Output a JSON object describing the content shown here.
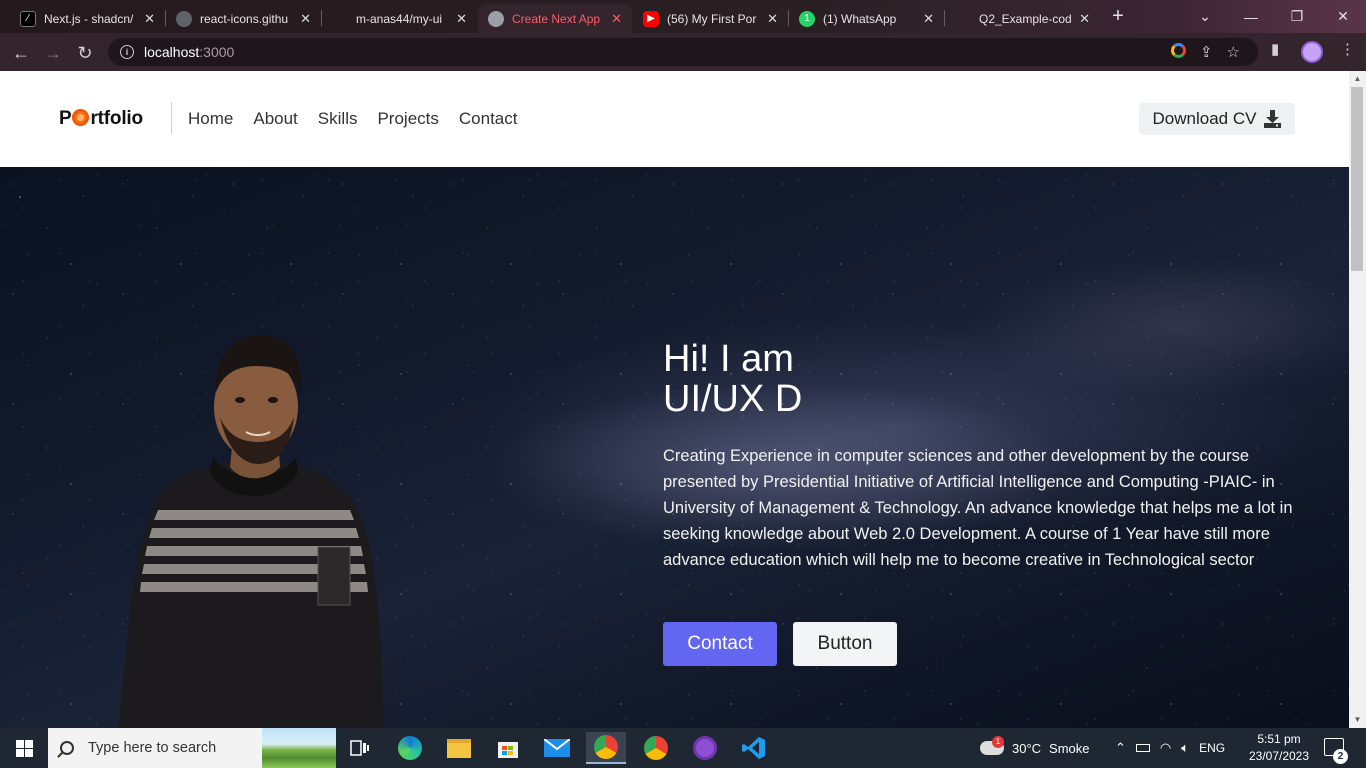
{
  "browser": {
    "tabs": [
      {
        "title": "Next.js - shadcn/",
        "icon": "nextjs-icon",
        "color": "#000000"
      },
      {
        "title": "react-icons.githu",
        "icon": "globe-icon",
        "color": "#5f6368"
      },
      {
        "title": "m-anas44/my-ui",
        "icon": "github-icon",
        "color": "#24292e"
      },
      {
        "title": "Create Next App",
        "icon": "globe-icon",
        "color": "#5f6368",
        "active": true
      },
      {
        "title": "(56) My First Por",
        "icon": "youtube-icon",
        "color": "#ff0000"
      },
      {
        "title": "(1) WhatsApp",
        "icon": "whatsapp-icon",
        "color": "#25d366"
      },
      {
        "title": "Q2_Example-cod",
        "icon": "github-icon",
        "color": "#24292e"
      }
    ],
    "url_host": "localhost",
    "url_port": ":3000",
    "active_tab_color": "#ff5b6a"
  },
  "site": {
    "logo": {
      "prefix": "P",
      "suffix": "rtfolio"
    },
    "nav": [
      "Home",
      "About",
      "Skills",
      "Projects",
      "Contact"
    ],
    "download_cv": "Download CV",
    "hero": {
      "title_line1": "Hi! I am",
      "title_line2": "UI/UX D",
      "description": "Creating Experience in computer sciences and other development by the course presented by Presidential Initiative of Artificial Intelligence and Computing -PIAIC- in University of Management & Technology. An advance knowledge that helps me a lot in seeking knowledge about Web 2.0 Development. A course of 1 Year have still more advance education which will help me to become creative in Technological sector",
      "primary_button": "Contact",
      "secondary_button": "Button"
    },
    "colors": {
      "accent": "#6366f1",
      "logo_orange": "#f97316"
    }
  },
  "taskbar": {
    "search_placeholder": "Type here to search",
    "weather": {
      "temp": "30°C",
      "condition": "Smoke",
      "badge": "1"
    },
    "language": "ENG",
    "time": "5:51 pm",
    "date": "23/07/2023",
    "notifications": "2",
    "apps": [
      "task-view-icon",
      "edge-icon",
      "file-explorer-icon",
      "store-icon",
      "mail-icon",
      "chrome-icon",
      "chrome-profile-icon",
      "github-desktop-icon",
      "vscode-icon"
    ]
  }
}
